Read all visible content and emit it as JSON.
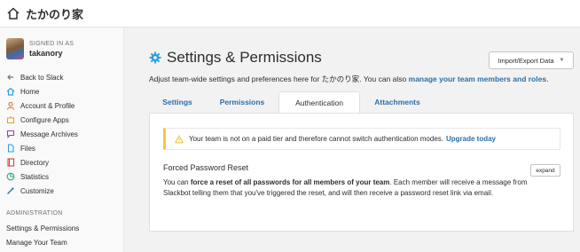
{
  "topbar": {
    "team_name": "たかのり家",
    "icon": "home-icon"
  },
  "user": {
    "signed_in_label": "SIGNED IN AS",
    "username": "takanory"
  },
  "sidebar": {
    "items": [
      {
        "label": "Back to Slack",
        "icon": "arrow-left-icon",
        "color": "#717274"
      },
      {
        "label": "Home",
        "icon": "home-icon",
        "color": "#2d9ee0"
      },
      {
        "label": "Account & Profile",
        "icon": "user-icon",
        "color": "#e06b2d"
      },
      {
        "label": "Configure Apps",
        "icon": "puzzle-icon",
        "color": "#e0a12d"
      },
      {
        "label": "Message Archives",
        "icon": "chat-icon",
        "color": "#8e44ad"
      },
      {
        "label": "Files",
        "icon": "file-icon",
        "color": "#2d9ee0"
      },
      {
        "label": "Directory",
        "icon": "book-icon",
        "color": "#e0402d"
      },
      {
        "label": "Statistics",
        "icon": "chart-icon",
        "color": "#2bac76"
      },
      {
        "label": "Customize",
        "icon": "wand-icon",
        "color": "#2d6ea9"
      }
    ],
    "admin_label": "ADMINISTRATION",
    "admin_items": [
      {
        "label": "Settings & Permissions"
      },
      {
        "label": "Manage Your Team"
      }
    ]
  },
  "main": {
    "title": "Settings & Permissions",
    "import_button": "Import/Export Data",
    "subtitle_prefix": "Adjust team-wide settings and preferences here for ",
    "subtitle_team": "たかのり家",
    "subtitle_middle": ". You can also ",
    "subtitle_link": "manage your team members and roles",
    "subtitle_suffix": ".",
    "tabs": [
      {
        "label": "Settings"
      },
      {
        "label": "Permissions"
      },
      {
        "label": "Authentication",
        "active": true
      },
      {
        "label": "Attachments"
      }
    ],
    "alert": {
      "text": "Your team is not on a paid tier and therefore cannot switch authentication modes.",
      "link": "Upgrade today"
    },
    "section": {
      "title": "Forced Password Reset",
      "expand_label": "expand",
      "desc_prefix": "You can ",
      "desc_bold": "force a reset of all passwords for all members of your team",
      "desc_suffix": ". Each member will receive a message from Slackbot telling them that you've triggered the reset, and will then receive a password reset link via email."
    }
  },
  "colors": {
    "link": "#2d6ea9",
    "warning": "#f2c744",
    "gear": "#2d9ee0"
  }
}
